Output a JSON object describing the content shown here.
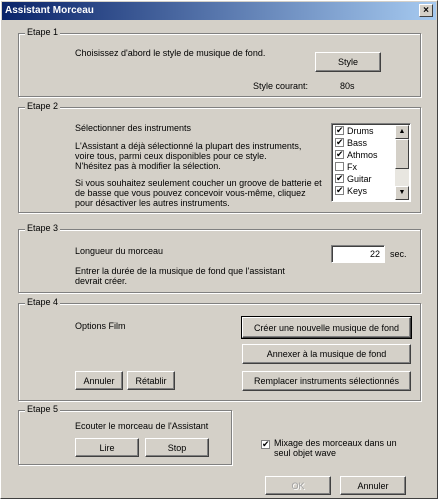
{
  "window": {
    "title": "Assistant Morceau",
    "close_glyph": "×"
  },
  "step1": {
    "legend": "Etape 1",
    "instruction": "Choisissez d'abord le style de musique de fond.",
    "style_button": "Style",
    "current_style_label": "Style courant:",
    "current_style_value": "80s"
  },
  "step2": {
    "legend": "Etape 2",
    "heading": "Sélectionner des instruments",
    "para1": [
      "L'Assistant a déjà sélectionné la plupart des instruments,",
      "voire tous, parmi ceux disponibles pour ce style.",
      "N'hésitez pas à modifier la sélection."
    ],
    "para2": [
      "Si vous souhaitez seulement coucher un groove de batterie et",
      "de basse que vous pouvez concevoir vous-même, cliquez",
      "pour désactiver les autres instruments."
    ],
    "instruments": [
      {
        "label": "Drums",
        "checked": true
      },
      {
        "label": "Bass",
        "checked": true
      },
      {
        "label": "Athmos",
        "checked": true
      },
      {
        "label": "Fx",
        "checked": false
      },
      {
        "label": "Guitar",
        "checked": true
      },
      {
        "label": "Keys",
        "checked": true
      }
    ]
  },
  "step3": {
    "legend": "Etape 3",
    "length_label": "Longueur du morceau",
    "length_value": "22",
    "unit": "sec.",
    "hint": [
      "Entrer la durée de la musique de fond que l'assistant",
      "devrait créer."
    ]
  },
  "step4": {
    "legend": "Etape 4",
    "film_options": "Options Film",
    "create_button": "Créer une nouvelle musique de fond",
    "append_button": "Annexer à la musique de fond",
    "replace_button": "Remplacer instruments sélectionnés",
    "undo_button": "Annuler",
    "redo_button": "Rétablir"
  },
  "step5": {
    "legend": "Etape 5",
    "listen_label": "Ecouter le morceau de l'Assistant",
    "play_button": "Lire",
    "stop_button": "Stop"
  },
  "mix": {
    "label": [
      "Mixage des morceaux dans un",
      "seul objet wave"
    ],
    "checked": true
  },
  "footer": {
    "ok_button": "OK",
    "cancel_button": "Annuler"
  },
  "icons": {
    "check": "✔",
    "scroll_up": "▲",
    "scroll_down": "▼"
  }
}
